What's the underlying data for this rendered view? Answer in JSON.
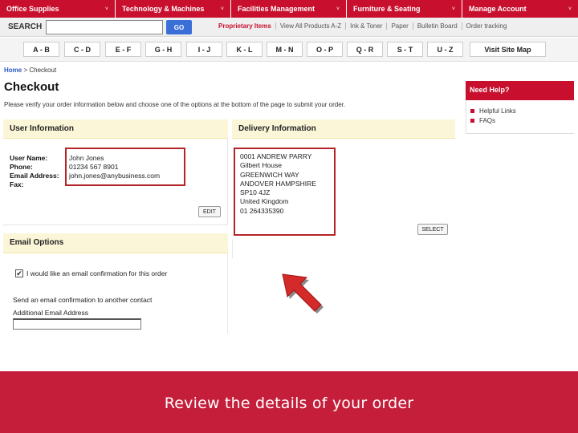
{
  "nav": {
    "categories": [
      {
        "label": "Office Supplies"
      },
      {
        "label": "Technology & Machines"
      },
      {
        "label": "Facilities Management"
      },
      {
        "label": "Furniture & Seating"
      },
      {
        "label": "Manage Account"
      }
    ],
    "chevron": "˅"
  },
  "search": {
    "label": "SEARCH",
    "value": "",
    "placeholder": "",
    "go_label": "GO"
  },
  "top_links": [
    "Proprietary Items",
    "View All Products A-Z",
    "Ink & Toner",
    "Paper",
    "Bulletin Board",
    "Order tracking"
  ],
  "alpha_index": [
    "A - B",
    "C - D",
    "E - F",
    "G - H",
    "I - J",
    "K - L",
    "M - N",
    "O - P",
    "Q - R",
    "S - T",
    "U - Z"
  ],
  "visit_site_map": "Visit Site Map",
  "breadcrumb": {
    "home": "Home",
    "separator": ">",
    "current": "Checkout"
  },
  "page_title": "Checkout",
  "instructions": "Please verify your order information below and choose one of the options at the bottom of the page to submit your order.",
  "user_info": {
    "heading": "User Information",
    "fields": [
      {
        "label": "User Name:",
        "value": "John Jones"
      },
      {
        "label": "Phone:",
        "value": "01234 567 8901"
      },
      {
        "label": "Email Address:",
        "value": "john.jones@anybusiness.com"
      },
      {
        "label": "Fax:",
        "value": ""
      }
    ],
    "edit_label": "EDIT"
  },
  "delivery_info": {
    "heading": "Delivery Information",
    "lines": [
      "0001 ANDREW PARRY",
      "Gilbert House",
      "GREENWICH WAY",
      "ANDOVER HAMPSHIRE",
      "SP10 4JZ",
      "United Kingdom",
      "01 264335390"
    ],
    "select_label": "SELECT"
  },
  "email_options": {
    "heading": "Email Options",
    "checkbox_label": "I would like an email confirmation for this order",
    "checked": true,
    "check_glyph": "✔",
    "other_contact": "Send an email confirmation to another contact",
    "additional_label": "Additional Email Address",
    "additional_value": ""
  },
  "help": {
    "heading": "Need Help?",
    "items": [
      "Helpful Links",
      "FAQs"
    ]
  },
  "caption": "Review the details of your order",
  "colors": {
    "brand_red": "#c8102e",
    "highlight_red": "#b32428",
    "panel_yellow": "#fbf6d8",
    "go_blue": "#3a6fd8"
  }
}
